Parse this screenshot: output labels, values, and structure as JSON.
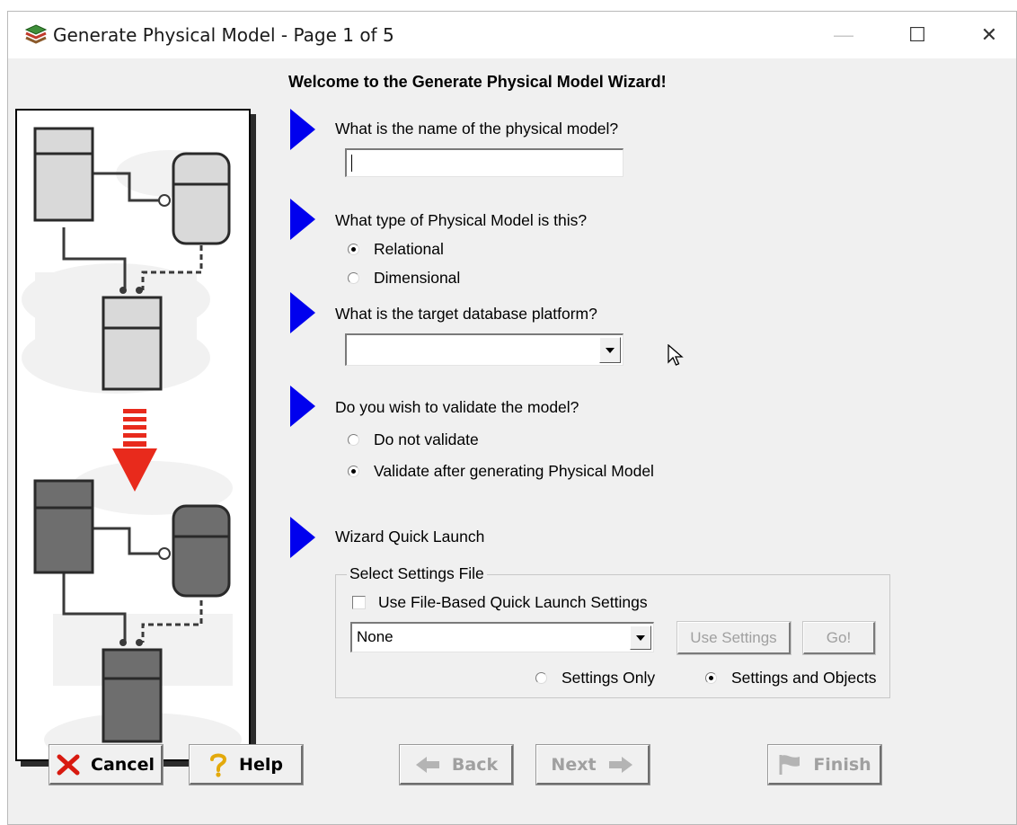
{
  "window": {
    "title": "Generate Physical Model - Page 1 of 5",
    "controls": {
      "minimize": "—",
      "maximize": "☐",
      "close": "✕"
    }
  },
  "welcome": "Welcome to the Generate Physical Model Wizard!",
  "questions": {
    "model_name": {
      "label": "What is the name of the physical model?",
      "value": ""
    },
    "model_type": {
      "label": "What type of Physical Model is this?",
      "options": [
        "Relational",
        "Dimensional"
      ],
      "selected": "Relational"
    },
    "platform": {
      "label": "What is the target database platform?",
      "value": ""
    },
    "validate": {
      "label": "Do you wish to validate the model?",
      "options": [
        "Do not validate",
        "Validate after generating Physical Model"
      ],
      "selected": "Validate after generating Physical Model"
    },
    "quick_launch": {
      "label": "Wizard Quick Launch",
      "group_title": "Select Settings File",
      "checkbox_label": "Use File-Based Quick Launch Settings",
      "checkbox_checked": false,
      "settings_file": "None",
      "use_settings_label": "Use Settings",
      "go_label": "Go!",
      "options": [
        "Settings Only",
        "Settings and Objects"
      ],
      "selected": "Settings and Objects"
    }
  },
  "footer": {
    "cancel": "Cancel",
    "help": "Help",
    "back": "Back",
    "next": "Next",
    "finish": "Finish"
  },
  "colors": {
    "arrow": "#0000ee",
    "down_arrow": "#e82a1c",
    "window_bg": "#f0f0f0",
    "entity_light": "#d9d9d9",
    "entity_dark": "#6e6e6e"
  },
  "icons": {
    "app": "layers-icon",
    "cancel": "red-x-icon",
    "help": "question-mark-icon",
    "back": "left-arrow-icon",
    "next": "right-arrow-icon",
    "finish": "flag-icon"
  }
}
